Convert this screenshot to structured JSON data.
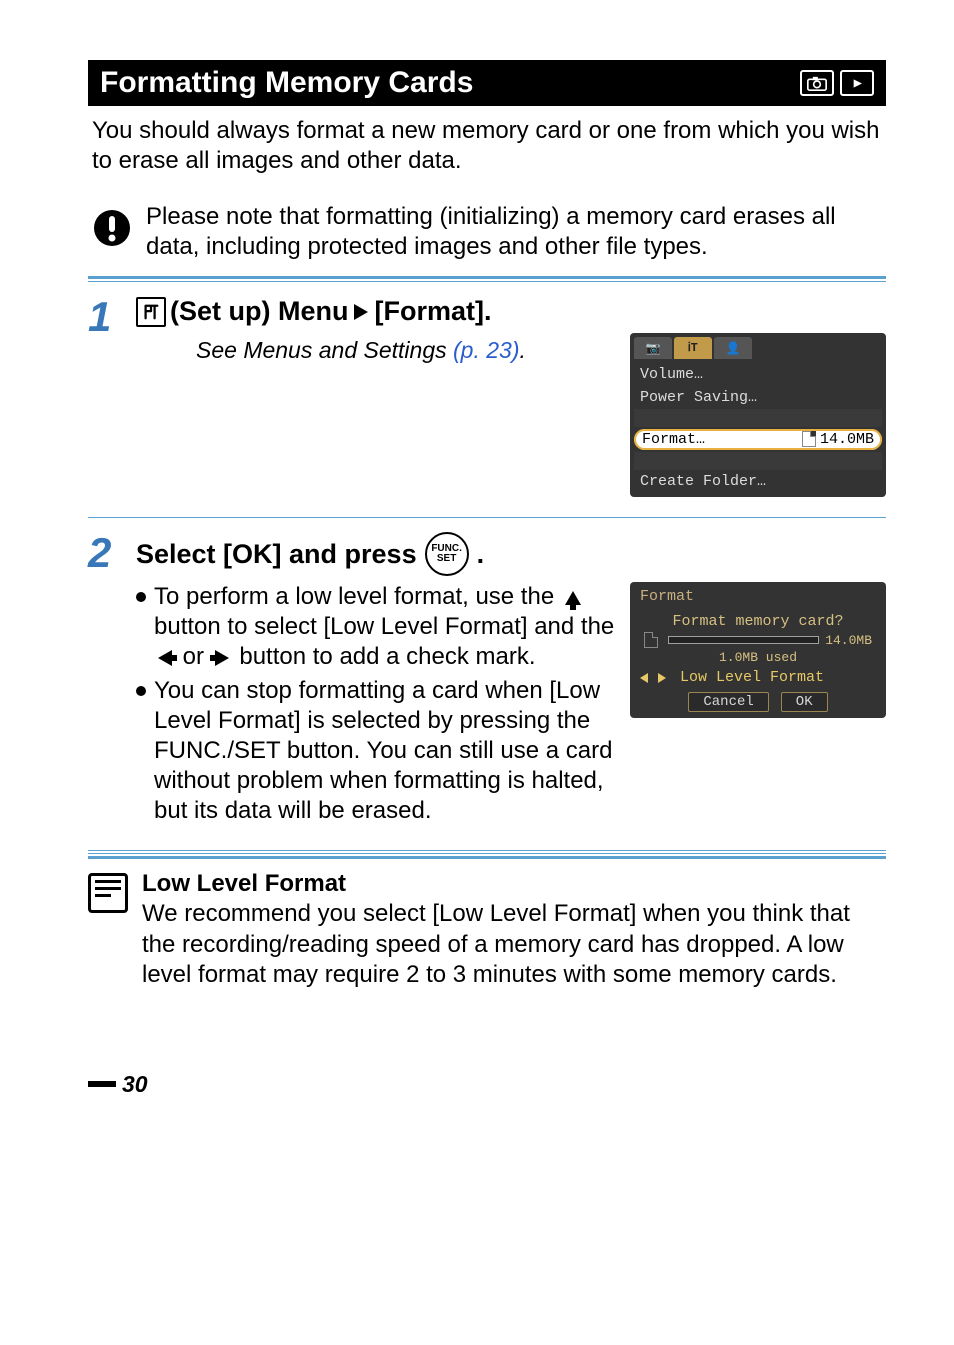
{
  "title": "Formatting Memory Cards",
  "intro": "You should always format a new memory card or one from which you wish to erase all images and other data.",
  "warning": "Please note that formatting (initializing) a memory card erases all data, including protected images and other file types.",
  "step1": {
    "num": "1",
    "heading_pre": "(Set up) Menu",
    "heading_post": "[Format].",
    "see_text": "See Menus and Settings ",
    "see_ref": "(p. 23)",
    "see_dot": "."
  },
  "menu": {
    "tabs": [
      "📷",
      "ᎥT",
      "👤"
    ],
    "items_top": [
      "Volume…",
      "Power Saving…"
    ],
    "hl_label": "Format…",
    "hl_value": "14.0MB",
    "items_bottom": [
      "Create Folder…"
    ]
  },
  "step2": {
    "num": "2",
    "heading_a": "Select [OK] and press ",
    "heading_b": ".",
    "func_top": "FUNC.",
    "func_bot": "SET",
    "bullets": [
      {
        "pre": "To perform a low level format, use the ",
        "mid1": " button to select [Low Level Format] and the ",
        "mid2": " or ",
        "post": " button to add a check mark."
      },
      {
        "text": "You can stop formatting a card when [Low Level Format] is selected by pressing the FUNC./SET button. You can still use a card without problem when formatting is halted, but its data will be erased."
      }
    ]
  },
  "formatDialog": {
    "title": "Format",
    "q": "Format memory card?",
    "total": "14.0MB",
    "used": "1.0MB used",
    "opt": "Low Level Format",
    "cancel": "Cancel",
    "ok": "OK"
  },
  "note": {
    "heading": "Low Level Format",
    "body": "We recommend you select [Low Level Format] when you think that the recording/reading speed of a memory card has dropped. A low level format may require 2 to 3 minutes with some memory cards."
  },
  "pageNumber": "30"
}
